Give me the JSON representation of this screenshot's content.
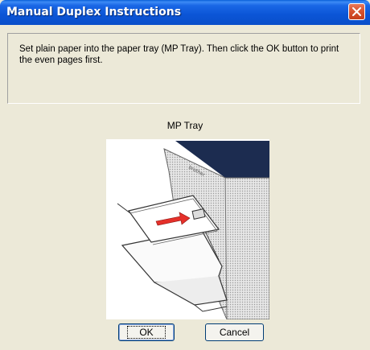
{
  "window": {
    "title": "Manual Duplex Instructions"
  },
  "message": "Set plain paper into the paper tray (MP Tray). Then click the OK button to print the even pages first.",
  "illustration": {
    "caption": "MP Tray",
    "brand_text": "brother"
  },
  "buttons": {
    "ok": "OK",
    "cancel": "Cancel"
  },
  "colors": {
    "titlebar": "#0a55d6",
    "close": "#d8532f",
    "dialog_bg": "#ece9d8",
    "arrow": "#e5302a"
  }
}
